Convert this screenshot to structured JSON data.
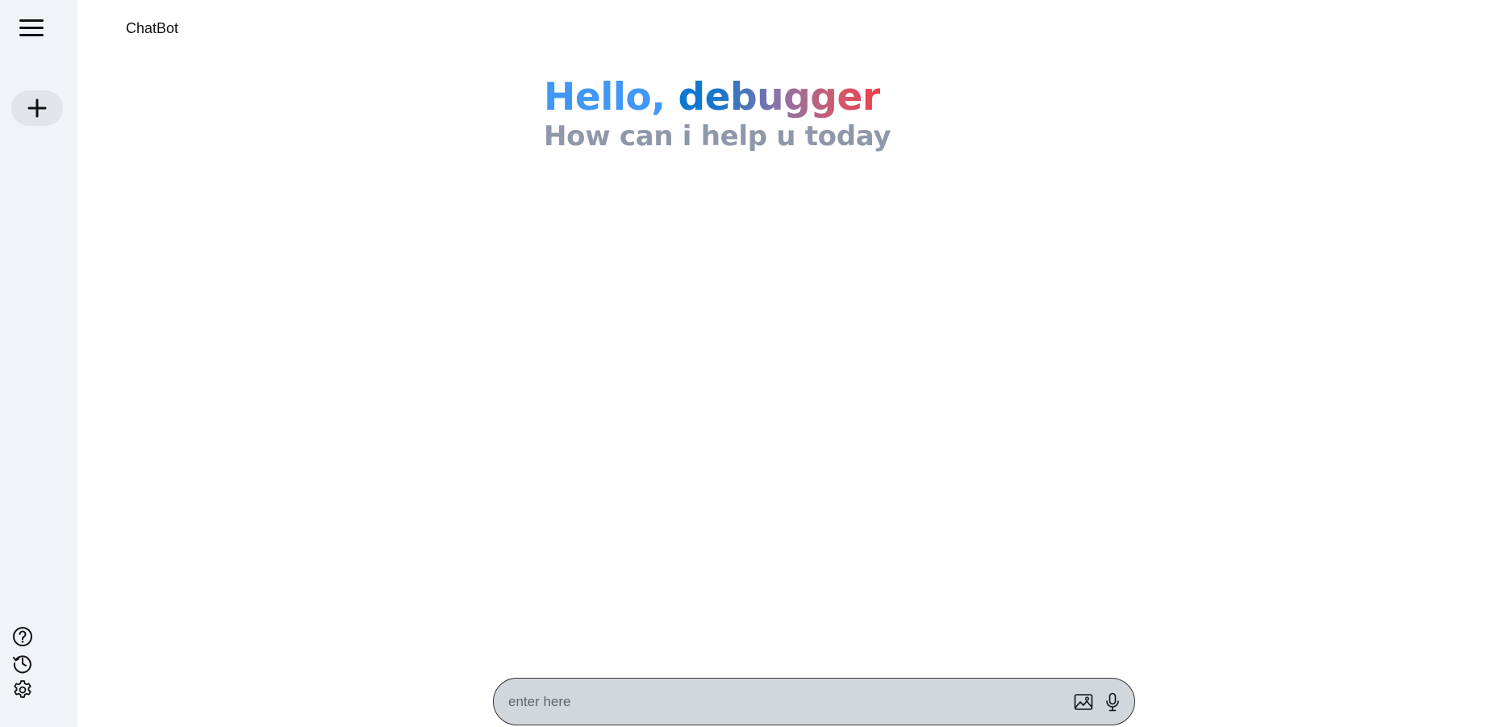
{
  "app": {
    "title": "ChatBot"
  },
  "sidebar": {
    "menu_icon": "hamburger-menu-icon",
    "new_chat_icon": "plus-icon",
    "bottom_items": [
      {
        "name": "help",
        "icon": "question-circle-icon"
      },
      {
        "name": "history",
        "icon": "history-clock-icon"
      },
      {
        "name": "settings",
        "icon": "gear-icon"
      }
    ]
  },
  "greeting": {
    "hello": "Hello, ",
    "name": "debugger",
    "subtitle": "How can i help u today"
  },
  "input": {
    "placeholder": "enter here",
    "value": "",
    "image_icon": "image-icon",
    "mic_icon": "microphone-icon"
  },
  "colors": {
    "sidebar_bg": "#f0f4f9",
    "hello_blue": "#4097f5",
    "gradient_start": "#0a78d4",
    "gradient_end": "#f03d4c",
    "subtitle_gray": "#8f98a8",
    "input_bg": "#d2d6dd"
  }
}
